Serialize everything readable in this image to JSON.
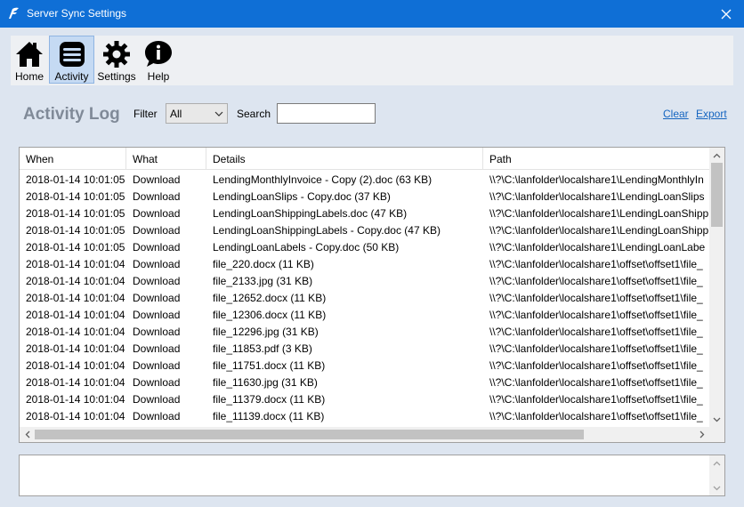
{
  "window": {
    "title": "Server Sync Settings"
  },
  "toolbar": {
    "items": [
      {
        "label": "Home",
        "icon": "home-icon",
        "active": false
      },
      {
        "label": "Activity",
        "icon": "activity-icon",
        "active": true
      },
      {
        "label": "Settings",
        "icon": "gear-icon",
        "active": false
      },
      {
        "label": "Help",
        "icon": "info-icon",
        "active": false
      }
    ]
  },
  "activity": {
    "heading": "Activity Log",
    "filter_label": "Filter",
    "filter_value": "All",
    "search_label": "Search",
    "search_value": "",
    "clear_label": "Clear",
    "export_label": "Export"
  },
  "table": {
    "columns": [
      "When",
      "What",
      "Details",
      "Path"
    ],
    "rows": [
      [
        "2018-01-14 10:01:05",
        "Download",
        "LendingMonthlyInvoice - Copy (2).doc (63 KB)",
        "\\\\?\\C:\\lanfolder\\localshare1\\LendingMonthlyIn"
      ],
      [
        "2018-01-14 10:01:05",
        "Download",
        "LendingLoanSlips - Copy.doc (37 KB)",
        "\\\\?\\C:\\lanfolder\\localshare1\\LendingLoanSlips"
      ],
      [
        "2018-01-14 10:01:05",
        "Download",
        "LendingLoanShippingLabels.doc (47 KB)",
        "\\\\?\\C:\\lanfolder\\localshare1\\LendingLoanShipp"
      ],
      [
        "2018-01-14 10:01:05",
        "Download",
        "LendingLoanShippingLabels - Copy.doc (47 KB)",
        "\\\\?\\C:\\lanfolder\\localshare1\\LendingLoanShipp"
      ],
      [
        "2018-01-14 10:01:05",
        "Download",
        "LendingLoanLabels - Copy.doc (50 KB)",
        "\\\\?\\C:\\lanfolder\\localshare1\\LendingLoanLabe"
      ],
      [
        "2018-01-14 10:01:04",
        "Download",
        "file_220.docx (11 KB)",
        "\\\\?\\C:\\lanfolder\\localshare1\\offset\\offset1\\file_"
      ],
      [
        "2018-01-14 10:01:04",
        "Download",
        "file_2133.jpg (31 KB)",
        "\\\\?\\C:\\lanfolder\\localshare1\\offset\\offset1\\file_"
      ],
      [
        "2018-01-14 10:01:04",
        "Download",
        "file_12652.docx (11 KB)",
        "\\\\?\\C:\\lanfolder\\localshare1\\offset\\offset1\\file_"
      ],
      [
        "2018-01-14 10:01:04",
        "Download",
        "file_12306.docx (11 KB)",
        "\\\\?\\C:\\lanfolder\\localshare1\\offset\\offset1\\file_"
      ],
      [
        "2018-01-14 10:01:04",
        "Download",
        "file_12296.jpg (31 KB)",
        "\\\\?\\C:\\lanfolder\\localshare1\\offset\\offset1\\file_"
      ],
      [
        "2018-01-14 10:01:04",
        "Download",
        "file_11853.pdf (3 KB)",
        "\\\\?\\C:\\lanfolder\\localshare1\\offset\\offset1\\file_"
      ],
      [
        "2018-01-14 10:01:04",
        "Download",
        "file_11751.docx (11 KB)",
        "\\\\?\\C:\\lanfolder\\localshare1\\offset\\offset1\\file_"
      ],
      [
        "2018-01-14 10:01:04",
        "Download",
        "file_11630.jpg (31 KB)",
        "\\\\?\\C:\\lanfolder\\localshare1\\offset\\offset1\\file_"
      ],
      [
        "2018-01-14 10:01:04",
        "Download",
        "file_11379.docx (11 KB)",
        "\\\\?\\C:\\lanfolder\\localshare1\\offset\\offset1\\file_"
      ],
      [
        "2018-01-14 10:01:04",
        "Download",
        "file_11139.docx (11 KB)",
        "\\\\?\\C:\\lanfolder\\localshare1\\offset\\offset1\\file_"
      ]
    ]
  },
  "colors": {
    "titlebar": "#0f6fd6",
    "link": "#1565c0",
    "heading": "#808a98",
    "background": "#dde5f0"
  }
}
